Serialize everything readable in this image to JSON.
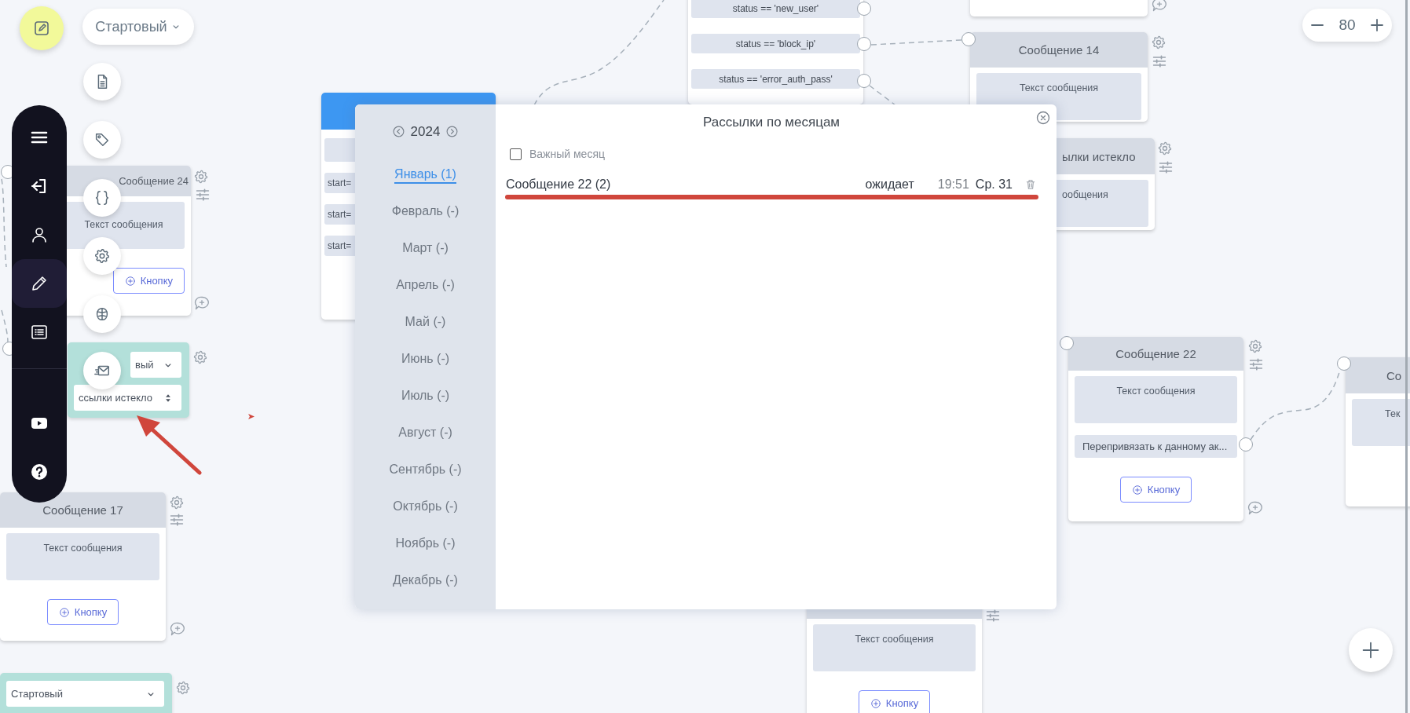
{
  "mode_selector": {
    "label": "Стартовый"
  },
  "sidebar": {
    "groups": [
      [
        {
          "kind": "menu",
          "selected": false
        },
        {
          "kind": "login",
          "selected": false
        },
        {
          "kind": "user",
          "selected": false
        },
        {
          "kind": "edit",
          "selected": true
        },
        {
          "kind": "list",
          "selected": false
        }
      ],
      [
        {
          "kind": "video",
          "selected": false
        },
        {
          "kind": "help",
          "selected": false
        }
      ]
    ]
  },
  "zoom": {
    "value": "80"
  },
  "canvas": {
    "nodes": [
      {
        "kind": "message",
        "title": "Сообщение 24",
        "text": "Текст сообщения",
        "button": "Кнопку"
      },
      {
        "kind": "select",
        "selects": [
          "вый",
          "ссылки истекло"
        ]
      },
      {
        "kind": "message",
        "title": "Сообщение 17",
        "text": "Текст сообщения",
        "button": "Кнопку"
      },
      {
        "kind": "select",
        "selects": [
          "Стартовый"
        ]
      },
      {
        "kind": "start",
        "rows": [
          "start=",
          "start=",
          "start="
        ]
      },
      {
        "kind": "condition",
        "rows": [
          "status == 'new_user'",
          "status == 'block_ip'",
          "status == 'error_auth_pass'"
        ]
      },
      {
        "kind": "message",
        "text": "Текст сообщения",
        "button": "Кнопку"
      },
      {
        "kind": "stub"
      },
      {
        "kind": "message",
        "title": "Сообщение 14",
        "text": "Текст сообщения"
      },
      {
        "kind": "message",
        "title": "ылки истекло",
        "text": "ообщения"
      },
      {
        "kind": "message",
        "title": "Сообщение 22",
        "text": "Текст сообщения",
        "rows": [
          "Перепривязать к данному ак..."
        ],
        "button": "Кнопку"
      },
      {
        "kind": "message",
        "title": "Со",
        "text": "Тек"
      }
    ]
  },
  "modal": {
    "title": "Рассылки по месяцам",
    "year": "2024",
    "months": [
      {
        "label": "Январь (1)",
        "selected": true
      },
      {
        "label": "Февраль (-)",
        "selected": false
      },
      {
        "label": "Март (-)",
        "selected": false
      },
      {
        "label": "Апрель (-)",
        "selected": false
      },
      {
        "label": "Май (-)",
        "selected": false
      },
      {
        "label": "Июнь (-)",
        "selected": false
      },
      {
        "label": "Июль (-)",
        "selected": false
      },
      {
        "label": "Август (-)",
        "selected": false
      },
      {
        "label": "Сентябрь (-)",
        "selected": false
      },
      {
        "label": "Октябрь (-)",
        "selected": false
      },
      {
        "label": "Ноябрь (-)",
        "selected": false
      },
      {
        "label": "Декабрь (-)",
        "selected": false
      }
    ],
    "important_month": {
      "label": "Важный месяц",
      "checked": false
    },
    "mailings": [
      {
        "name": "Сообщение 22 (2)",
        "status": "ожидает",
        "time": "19:51",
        "date": "Ср. 31"
      }
    ]
  }
}
